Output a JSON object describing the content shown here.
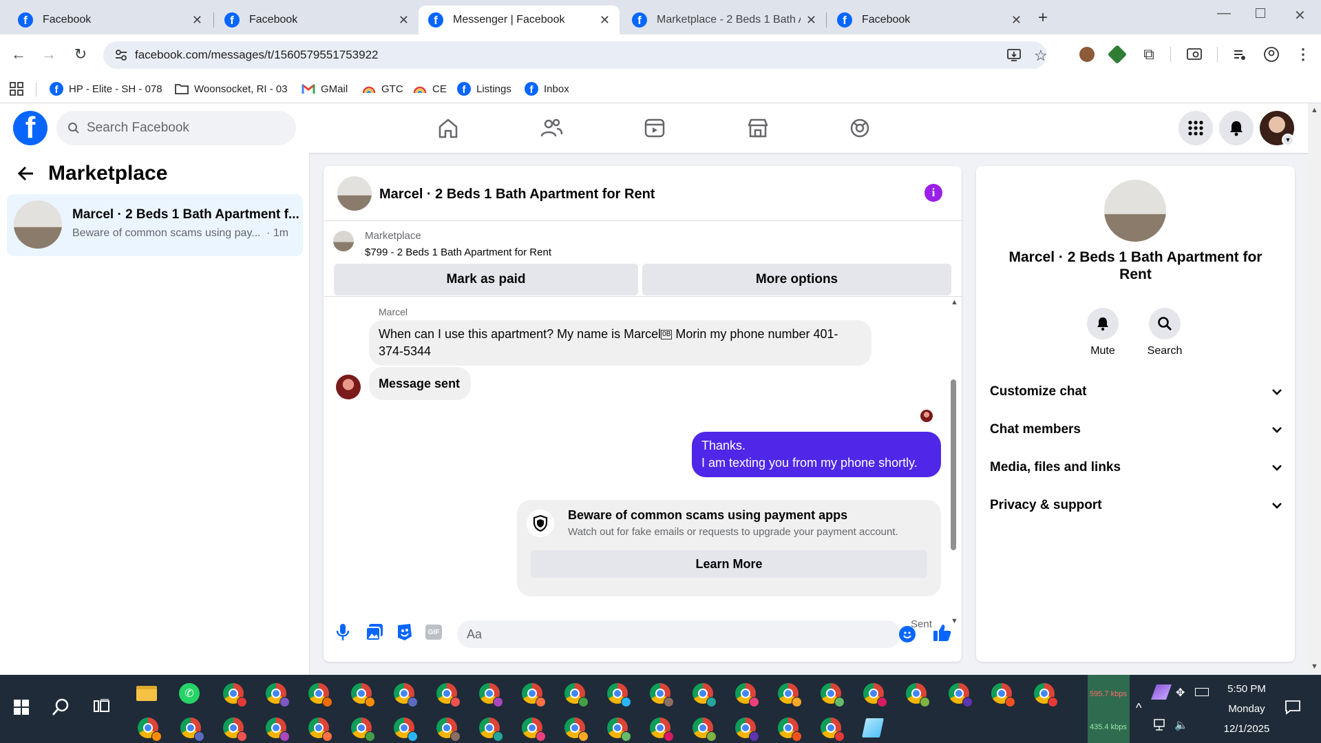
{
  "browser": {
    "tabs": [
      {
        "title": "Facebook",
        "active": false
      },
      {
        "title": "Facebook",
        "active": false
      },
      {
        "title": "Messenger | Facebook",
        "active": true
      },
      {
        "title": "Marketplace - 2 Beds 1 Bath Ap",
        "active": false
      },
      {
        "title": "Facebook",
        "active": false
      }
    ],
    "url": "facebook.com/messages/t/1560579551753922",
    "bookmarks": [
      {
        "label": "HP - Elite - SH - 078",
        "icon": "facebook-icon"
      },
      {
        "label": "Woonsocket, RI - 03",
        "icon": "folder-icon"
      },
      {
        "label": "GMail",
        "icon": "gmail-icon"
      },
      {
        "label": "GTC",
        "icon": "rainbow-icon"
      },
      {
        "label": "CE",
        "icon": "rainbow-icon"
      },
      {
        "label": "Listings",
        "icon": "facebook-icon"
      },
      {
        "label": "Inbox",
        "icon": "facebook-icon"
      }
    ]
  },
  "fb": {
    "search_placeholder": "Search Facebook",
    "accent": "#0866ff"
  },
  "left": {
    "title": "Marketplace",
    "chat": {
      "name": "Marcel · 2 Beds 1 Bath Apartment f...",
      "preview": "Beware of common scams using pay...",
      "time": "· 1m"
    }
  },
  "chat": {
    "header_title": "Marcel · 2 Beds 1 Bath Apartment for Rent",
    "listing_source": "Marketplace",
    "listing_title": "$799 - 2 Beds 1 Bath Apartment for Rent",
    "mark_paid": "Mark as paid",
    "more_options": "More options",
    "sender_name": "Marcel",
    "incoming_1a": "When can I use this apartment? My name is Marcel",
    "incoming_1_glyph": "0B",
    "incoming_1b": " Morin my phone number 401-374-5344",
    "incoming_2": "Message sent",
    "outgoing_line1": "Thanks.",
    "outgoing_line2": "I am texting you from my phone shortly.",
    "outgoing_color": "#4f27e8",
    "notice_title": "Beware of common scams using payment apps",
    "notice_body": "Watch out for fake emails or requests to upgrade your payment account.",
    "learn_more": "Learn More",
    "sent_status": "Sent",
    "composer_placeholder": "Aa"
  },
  "right": {
    "title": "Marcel · 2 Beds 1 Bath Apartment for Rent",
    "mute": "Mute",
    "search": "Search",
    "sections": [
      "Customize chat",
      "Chat members",
      "Media, files and links",
      "Privacy & support"
    ]
  },
  "taskbar": {
    "net_up": "595.7 kbps",
    "net_down": "435.4 kbps",
    "time": "5:50 PM",
    "day": "Monday",
    "date": "12/1/2025"
  }
}
